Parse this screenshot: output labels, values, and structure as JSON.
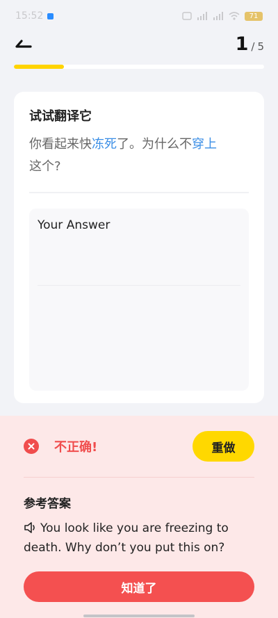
{
  "status_bar": {
    "time": "15:52",
    "battery": "71"
  },
  "header": {
    "current": "1",
    "separator": "/",
    "total": "5",
    "progress": 0.2
  },
  "question": {
    "title": "试试翻译它",
    "sentence_parts": [
      {
        "text": "你看起来快",
        "highlight": false
      },
      {
        "text": "冻死",
        "highlight": true
      },
      {
        "text": "了。为什么不",
        "highlight": false
      },
      {
        "text": "穿上",
        "highlight": true
      },
      {
        "text": "这个?",
        "highlight": false
      }
    ],
    "answer_label": "Your Answer"
  },
  "feedback": {
    "status": "不正确!",
    "redo_label": "重做",
    "reference_title": "参考答案",
    "reference_answer": "You look like you are freezing to death. Why don’t you put this on?",
    "confirm_label": "知道了"
  },
  "colors": {
    "accent_yellow": "#ffd400",
    "highlight_blue": "#3a8ee6",
    "error_red": "#f04d4d",
    "feedback_bg": "#fde8e8"
  },
  "icons": [
    "back-arrow-icon",
    "close-circle-icon",
    "speaker-icon",
    "wifi-icon",
    "signal-icon",
    "battery-icon"
  ]
}
